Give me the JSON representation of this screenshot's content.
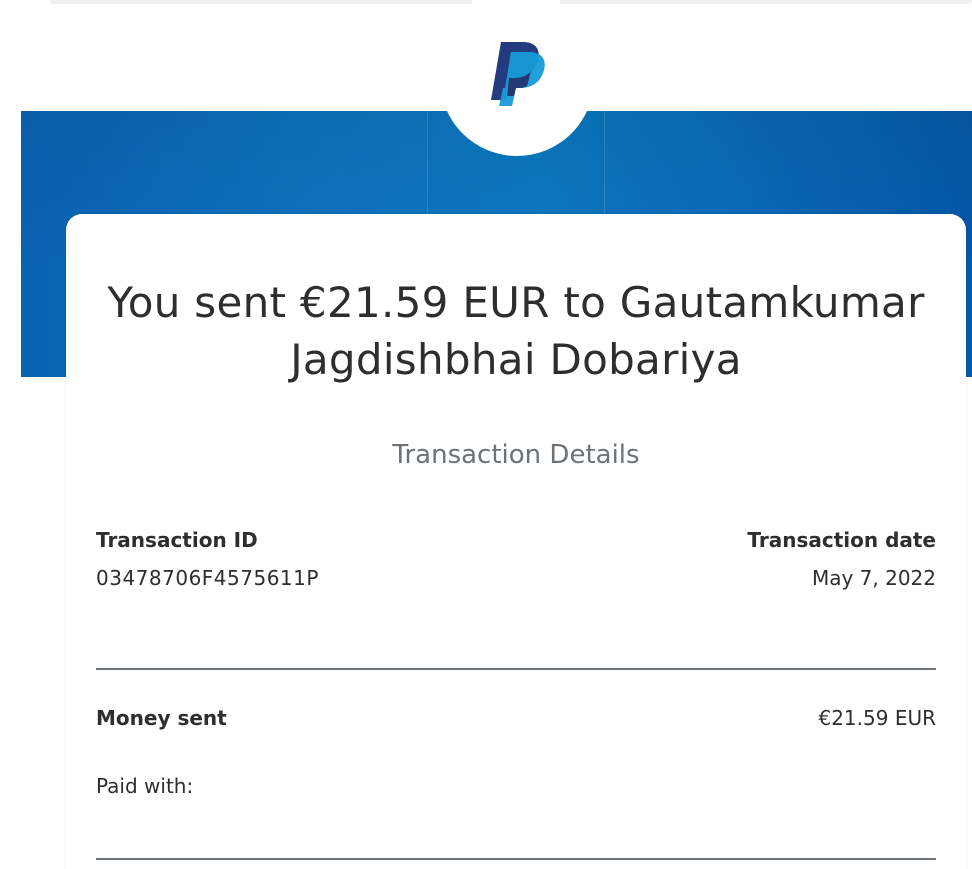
{
  "brand": {
    "logo_name": "paypal-logo",
    "colors": {
      "banner_blue": "#0a6bb8",
      "logo_dark": "#253b80",
      "logo_light": "#179bd7",
      "text_primary": "#2c2e2f",
      "text_secondary": "#6c7378"
    }
  },
  "headline": {
    "line1": "You sent €21.59 EUR to Gautamkumar",
    "line2": "Jagdishbhai Dobariya"
  },
  "section_title": "Transaction Details",
  "transaction": {
    "id_label": "Transaction ID",
    "id_value": "03478706F4575611P",
    "date_label": "Transaction date",
    "date_value": "May 7, 2022"
  },
  "summary": {
    "money_sent_label": "Money sent",
    "money_sent_value": "€21.59 EUR",
    "paid_with_label": "Paid with:"
  }
}
